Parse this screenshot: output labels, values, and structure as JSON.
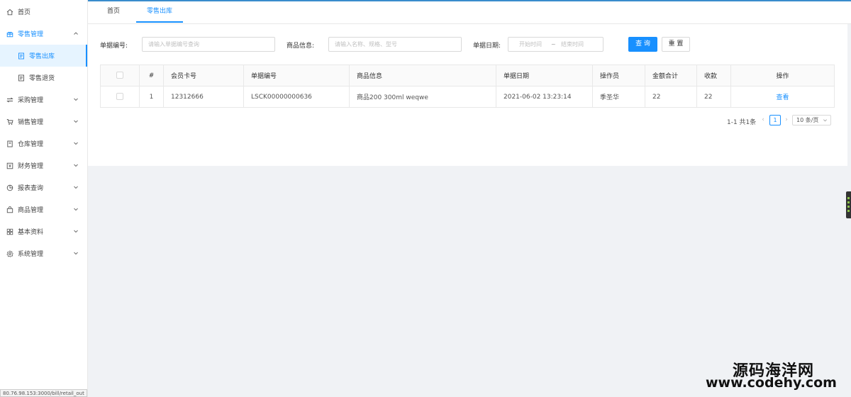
{
  "sidebar": {
    "items": [
      {
        "label": "首页",
        "icon": "home-icon",
        "expandable": false
      },
      {
        "label": "零售管理",
        "icon": "gift-icon",
        "expandable": true,
        "open": true,
        "children": [
          {
            "label": "零售出库",
            "icon": "doc-icon",
            "active": true
          },
          {
            "label": "零售退货",
            "icon": "doc-icon",
            "active": false
          }
        ]
      },
      {
        "label": "采购管理",
        "icon": "swap-icon",
        "expandable": true
      },
      {
        "label": "销售管理",
        "icon": "cart-icon",
        "expandable": true
      },
      {
        "label": "仓库管理",
        "icon": "book-icon",
        "expandable": true
      },
      {
        "label": "财务管理",
        "icon": "money-icon",
        "expandable": true
      },
      {
        "label": "报表查询",
        "icon": "pie-icon",
        "expandable": true
      },
      {
        "label": "商品管理",
        "icon": "bag-icon",
        "expandable": true
      },
      {
        "label": "基本资料",
        "icon": "grid-icon",
        "expandable": true
      },
      {
        "label": "系统管理",
        "icon": "gear-icon",
        "expandable": true
      }
    ]
  },
  "status_url": "80.76.98.153:3000/bill/retail_out",
  "tabs": [
    {
      "label": "首页",
      "active": false
    },
    {
      "label": "零售出库",
      "active": true
    }
  ],
  "filters": {
    "bill_no_label": "单据编号:",
    "bill_no_placeholder": "请输入单据编号查询",
    "goods_label": "商品信息:",
    "goods_placeholder": "请输入名称、规格、型号",
    "date_label": "单据日期:",
    "date_start_placeholder": "开始时间",
    "date_sep": "~",
    "date_end_placeholder": "结束时间",
    "search_button": "查 询",
    "reset_button": "重 置"
  },
  "table": {
    "columns": [
      "#",
      "会员卡号",
      "单据编号",
      "商品信息",
      "单据日期",
      "操作员",
      "金额合计",
      "收款",
      "操作"
    ],
    "rows": [
      {
        "index": "1",
        "member_card": "12312666",
        "bill_no": "LSCK00000000636",
        "goods": "商品200 300ml weqwe",
        "date": "2021-06-02 13:23:14",
        "operator": "季圣华",
        "amount": "22",
        "received": "22",
        "action": "查看"
      }
    ]
  },
  "pagination": {
    "total_text": "1-1 共1条",
    "current_page": "1",
    "page_size": "10 条/页"
  },
  "watermark": {
    "line1": "源码海洋网",
    "line2": "www.codehy.com"
  },
  "colors": {
    "accent": "#1890ff",
    "topbar_border": "#3a8ccd"
  }
}
